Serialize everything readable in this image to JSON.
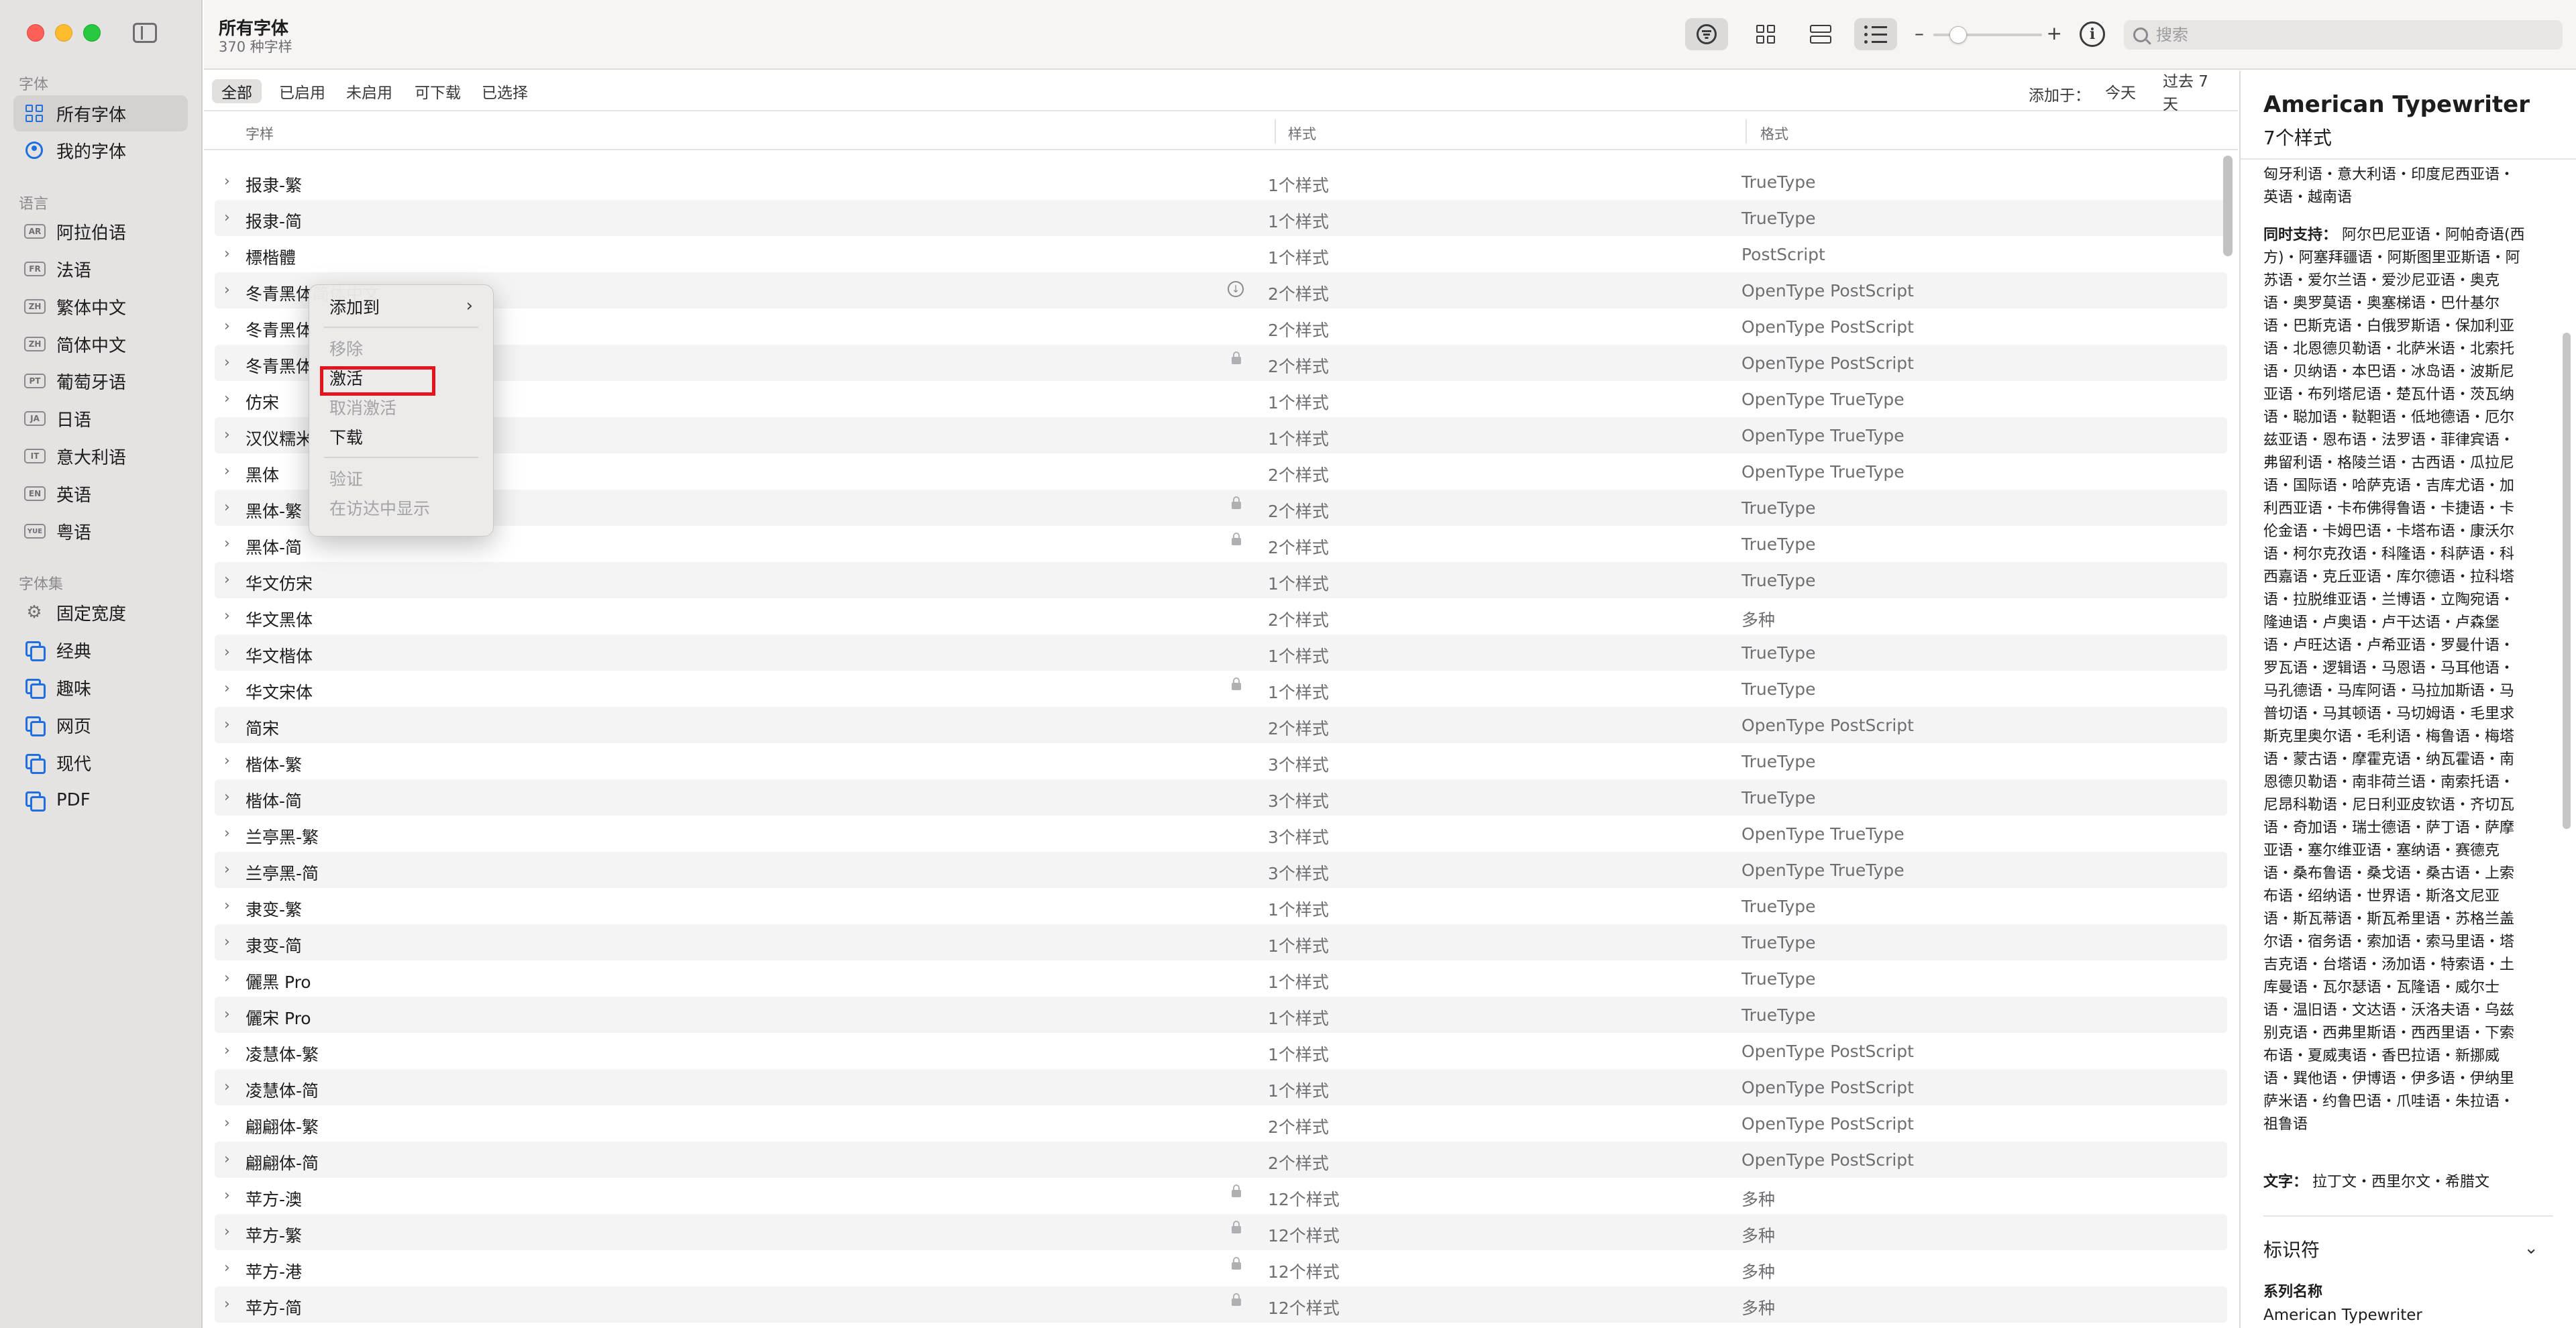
{
  "window": {
    "title": "所有字体",
    "subtitle": "370 种字样"
  },
  "sidebar": {
    "section_fonts": "字体",
    "items_fonts": [
      {
        "label": "所有字体",
        "icon": "grid-icon",
        "active": true
      },
      {
        "label": "我的字体",
        "icon": "person-icon",
        "active": false
      }
    ],
    "section_language": "语言",
    "languages": [
      {
        "code": "AR",
        "label": "阿拉伯语"
      },
      {
        "code": "FR",
        "label": "法语"
      },
      {
        "code": "ZH",
        "label": "繁体中文"
      },
      {
        "code": "ZH",
        "label": "简体中文"
      },
      {
        "code": "PT",
        "label": "葡萄牙语"
      },
      {
        "code": "JA",
        "label": "日语"
      },
      {
        "code": "IT",
        "label": "意大利语"
      },
      {
        "code": "EN",
        "label": "英语"
      },
      {
        "code": "YUE",
        "label": "粤语"
      }
    ],
    "section_collections": "字体集",
    "collections": [
      {
        "label": "固定宽度",
        "icon": "gear-icon"
      },
      {
        "label": "经典",
        "icon": "collection-icon"
      },
      {
        "label": "趣味",
        "icon": "collection-icon"
      },
      {
        "label": "网页",
        "icon": "collection-icon"
      },
      {
        "label": "现代",
        "icon": "collection-icon"
      },
      {
        "label": "PDF",
        "icon": "collection-icon"
      }
    ]
  },
  "toolbar": {
    "search_placeholder": "搜索",
    "zoom_minus": "–",
    "zoom_plus": "+",
    "info_icon": "i"
  },
  "filters": {
    "chips": [
      "全部",
      "已启用",
      "未启用",
      "可下载",
      "已选择"
    ],
    "selected": "全部",
    "added_label": "添加于：",
    "added_today": "今天",
    "added_7days": "过去 7 天"
  },
  "table": {
    "headers": [
      "字样",
      "样式",
      "格式"
    ],
    "rows": [
      {
        "name": "报隶-繁",
        "styles": "1个样式",
        "format": "TrueType",
        "badge": ""
      },
      {
        "name": "报隶-简",
        "styles": "1个样式",
        "format": "TrueType",
        "badge": ""
      },
      {
        "name": "標楷體",
        "styles": "1个样式",
        "format": "PostScript",
        "badge": ""
      },
      {
        "name": "冬青黑体简体中文",
        "styles": "2个样式",
        "format": "OpenType PostScript",
        "badge": "download"
      },
      {
        "name": "冬青黑体",
        "styles": "2个样式",
        "format": "OpenType PostScript",
        "badge": ""
      },
      {
        "name": "冬青黑体",
        "styles": "2个样式",
        "format": "OpenType PostScript",
        "badge": "lock"
      },
      {
        "name": "仿宋",
        "styles": "1个样式",
        "format": "OpenType TrueType",
        "badge": ""
      },
      {
        "name": "汉仪糯米",
        "styles": "1个样式",
        "format": "OpenType TrueType",
        "badge": ""
      },
      {
        "name": "黑体",
        "styles": "2个样式",
        "format": "OpenType TrueType",
        "badge": ""
      },
      {
        "name": "黑体-繁",
        "styles": "2个样式",
        "format": "TrueType",
        "badge": "lock"
      },
      {
        "name": "黑体-简",
        "styles": "2个样式",
        "format": "TrueType",
        "badge": "lock"
      },
      {
        "name": "华文仿宋",
        "styles": "1个样式",
        "format": "TrueType",
        "badge": ""
      },
      {
        "name": "华文黑体",
        "styles": "2个样式",
        "format": "多种",
        "badge": ""
      },
      {
        "name": "华文楷体",
        "styles": "1个样式",
        "format": "TrueType",
        "badge": ""
      },
      {
        "name": "华文宋体",
        "styles": "1个样式",
        "format": "TrueType",
        "badge": "lock"
      },
      {
        "name": "简宋",
        "styles": "2个样式",
        "format": "OpenType PostScript",
        "badge": ""
      },
      {
        "name": "楷体-繁",
        "styles": "3个样式",
        "format": "TrueType",
        "badge": ""
      },
      {
        "name": "楷体-简",
        "styles": "3个样式",
        "format": "TrueType",
        "badge": ""
      },
      {
        "name": "兰亭黑-繁",
        "styles": "3个样式",
        "format": "OpenType TrueType",
        "badge": ""
      },
      {
        "name": "兰亭黑-简",
        "styles": "3个样式",
        "format": "OpenType TrueType",
        "badge": ""
      },
      {
        "name": "隶变-繁",
        "styles": "1个样式",
        "format": "TrueType",
        "badge": ""
      },
      {
        "name": "隶变-简",
        "styles": "1个样式",
        "format": "TrueType",
        "badge": ""
      },
      {
        "name": "儷黑 Pro",
        "styles": "1个样式",
        "format": "TrueType",
        "badge": ""
      },
      {
        "name": "儷宋 Pro",
        "styles": "1个样式",
        "format": "TrueType",
        "badge": ""
      },
      {
        "name": "凌慧体-繁",
        "styles": "1个样式",
        "format": "OpenType PostScript",
        "badge": ""
      },
      {
        "name": "凌慧体-简",
        "styles": "1个样式",
        "format": "OpenType PostScript",
        "badge": ""
      },
      {
        "name": "翩翩体-繁",
        "styles": "2个样式",
        "format": "OpenType PostScript",
        "badge": ""
      },
      {
        "name": "翩翩体-简",
        "styles": "2个样式",
        "format": "OpenType PostScript",
        "badge": ""
      },
      {
        "name": "苹方-澳",
        "styles": "12个样式",
        "format": "多种",
        "badge": "lock"
      },
      {
        "name": "苹方-繁",
        "styles": "12个样式",
        "format": "多种",
        "badge": "lock"
      },
      {
        "name": "苹方-港",
        "styles": "12个样式",
        "format": "多种",
        "badge": "lock"
      },
      {
        "name": "苹方-简",
        "styles": "12个样式",
        "format": "多种",
        "badge": "lock"
      }
    ]
  },
  "context_menu": {
    "items": [
      {
        "label": "添加到",
        "enabled": true,
        "submenu": true
      },
      {
        "sep": true
      },
      {
        "label": "移除",
        "enabled": false
      },
      {
        "label": "激活",
        "enabled": true,
        "highlighted": true
      },
      {
        "label": "取消激活",
        "enabled": false
      },
      {
        "label": "下载",
        "enabled": true
      },
      {
        "sep": true
      },
      {
        "label": "验证",
        "enabled": false
      },
      {
        "label": "在访达中显示",
        "enabled": false
      }
    ]
  },
  "info_pane": {
    "title": "American Typewriter",
    "subtitle": "7个样式",
    "top_text": "匈牙利语・意大利语・印度尼西亚语・英语・越南语",
    "also_supports_label": "同时支持：",
    "also_supports_text": "阿尔巴尼亚语・阿帕奇语(西方)・阿塞拜疆语・阿斯图里亚斯语・阿苏语・爱尔兰语・爱沙尼亚语・奥克语・奥罗莫语・奥塞梯语・巴什基尔语・巴斯克语・白俄罗斯语・保加利亚语・北恩德贝勒语・北萨米语・北索托语・贝纳语・本巴语・冰岛语・波斯尼亚语・布列塔尼语・楚瓦什语・茨瓦纳语・聪加语・鞑靼语・低地德语・厄尔兹亚语・恩布语・法罗语・菲律宾语・弗留利语・格陵兰语・古西语・瓜拉尼语・国际语・哈萨克语・吉库尤语・加利西亚语・卡布佛得鲁语・卡捷语・卡伦金语・卡姆巴语・卡塔布语・康沃尔语・柯尔克孜语・科隆语・科萨语・科西嘉语・克丘亚语・库尔德语・拉科塔语・拉脱维亚语・兰博语・立陶宛语・隆迪语・卢奥语・卢干达语・卢森堡语・卢旺达语・卢希亚语・罗曼什语・罗瓦语・逻辑语・马恩语・马耳他语・马孔德语・马库阿语・马拉加斯语・马普切语・马其顿语・马切姆语・毛里求斯克里奥尔语・毛利语・梅鲁语・梅塔语・蒙古语・摩霍克语・纳瓦霍语・南恩德贝勒语・南非荷兰语・南索托语・尼昂科勒语・尼日利亚皮钦语・齐切瓦语・奇加语・瑞士德语・萨丁语・萨摩亚语・塞尔维亚语・塞纳语・赛德克语・桑布鲁语・桑戈语・桑古语・上索布语・绍纳语・世界语・斯洛文尼亚语・斯瓦蒂语・斯瓦希里语・苏格兰盖尔语・宿务语・索加语・索马里语・塔吉克语・台塔语・汤加语・特索语・土库曼语・瓦尔瑟语・瓦隆语・威尔士语・温旧语・文达语・沃洛夫语・乌兹别克语・西弗里斯语・西西里语・下索布语・夏威夷语・香巴拉语・新挪威语・巽他语・伊博语・伊多语・伊纳里萨米语・约鲁巴语・爪哇语・朱拉语・祖鲁语",
    "scripts_label": "文字：",
    "scripts_text": "拉丁文・西里尔文・希腊文",
    "section_identifier": "标识符",
    "family_label": "系列名称",
    "family_value": "American Typewriter"
  }
}
